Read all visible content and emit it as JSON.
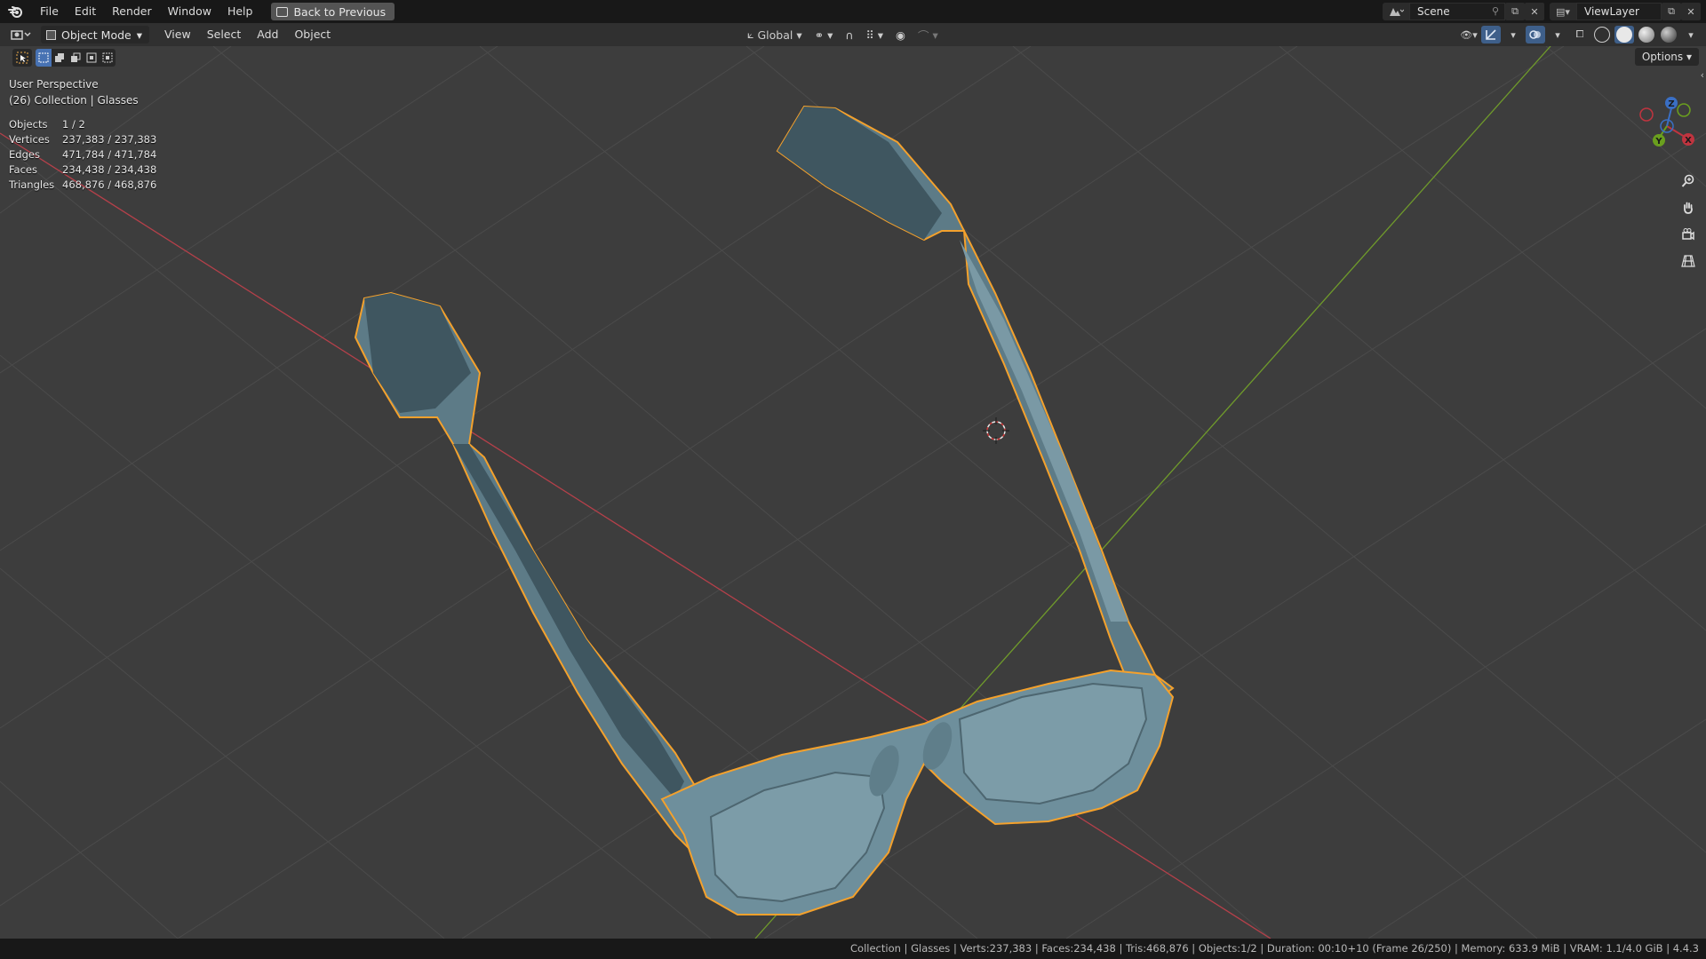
{
  "topbar": {
    "menus": [
      "File",
      "Edit",
      "Render",
      "Window",
      "Help"
    ],
    "back_label": "Back to Previous",
    "scene_name": "Scene",
    "view_layer": "ViewLayer"
  },
  "header": {
    "mode": "Object Mode",
    "menus": [
      "View",
      "Select",
      "Add",
      "Object"
    ],
    "transform_orientation": "Global"
  },
  "viewport": {
    "options_label": "Options",
    "perspective": "User Perspective",
    "collection_line": "(26) Collection | Glasses",
    "stats": [
      {
        "label": "Objects",
        "value": "1 / 2"
      },
      {
        "label": "Vertices",
        "value": "237,383 / 237,383"
      },
      {
        "label": "Edges",
        "value": "471,784 / 471,784"
      },
      {
        "label": "Faces",
        "value": "234,438 / 234,438"
      },
      {
        "label": "Triangles",
        "value": "468,876 / 468,876"
      }
    ],
    "gizmo_axes": {
      "x": "X",
      "y": "Y",
      "z": "Z"
    },
    "colors": {
      "x_axis": "#c0343f",
      "y_axis": "#6a9f1e",
      "z_axis": "#3a6fc4",
      "outline": "#f4a12c",
      "mesh": "#6e8f9c"
    }
  },
  "statusbar": {
    "text": "Collection | Glasses | Verts:237,383 | Faces:234,438 | Tris:468,876 | Objects:1/2 | Duration: 00:10+10 (Frame 26/250) | Memory: 633.9 MiB | VRAM: 1.1/4.0 GiB | 4.4.3"
  }
}
